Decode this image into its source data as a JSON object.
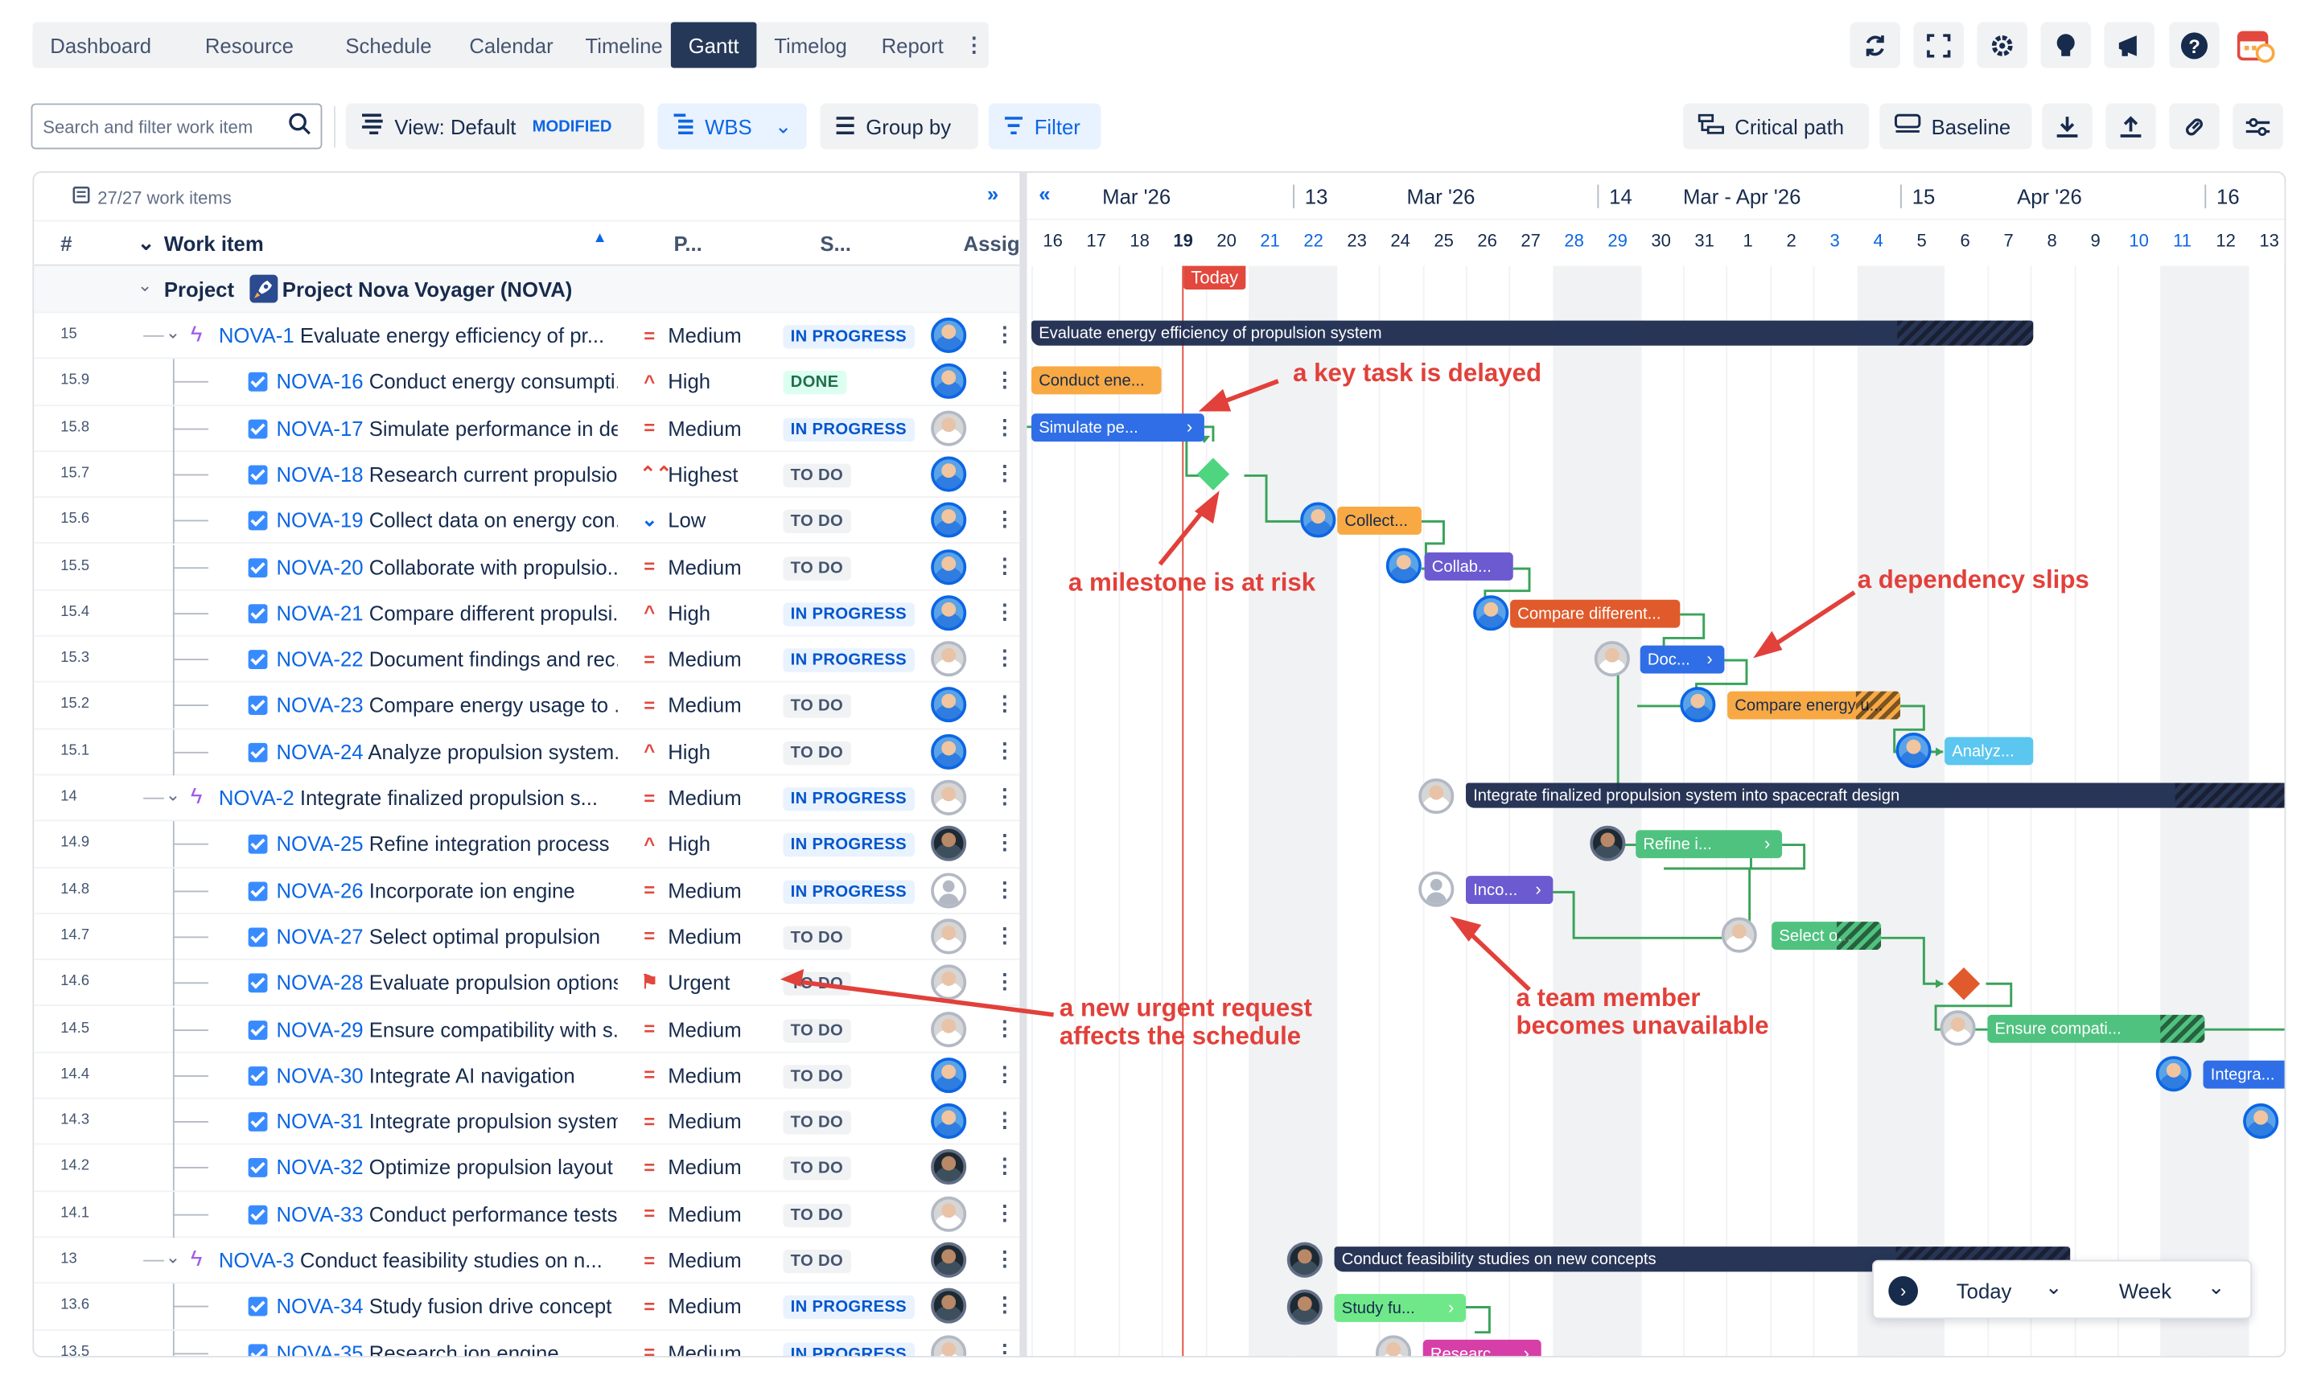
{
  "tabs": [
    "Dashboard",
    "Resource",
    "Schedule",
    "Calendar",
    "Timeline",
    "Gantt",
    "Timelog",
    "Report"
  ],
  "active_tab": "Gantt",
  "search": {
    "placeholder": "Search and filter work item"
  },
  "toolbar": {
    "view_label": "View: Default",
    "view_badge": "MODIFIED",
    "wbs_label": "WBS",
    "group_label": "Group by",
    "filter_label": "Filter",
    "critical_label": "Critical path",
    "baseline_label": "Baseline"
  },
  "list": {
    "count": "27/27 work items",
    "col_num": "#",
    "col_work": "Work item",
    "col_pri": "P...",
    "col_status": "S...",
    "col_assignee": "Assig",
    "project_label": "Project",
    "project_name": "Project Nova Voyager (NOVA)"
  },
  "rows": [
    {
      "num": "15",
      "key": "NOVA-1",
      "title": "Evaluate energy efficiency of pr...",
      "priority": "Medium",
      "status": "IN PROGRESS",
      "level": 1,
      "avatar": "a"
    },
    {
      "num": "15.9",
      "key": "NOVA-16",
      "title": "Conduct energy consumpti...",
      "priority": "High",
      "status": "DONE",
      "level": 2,
      "avatar": "a"
    },
    {
      "num": "15.8",
      "key": "NOVA-17",
      "title": "Simulate performance in de...",
      "priority": "Medium",
      "status": "IN PROGRESS",
      "level": 2,
      "avatar": "b"
    },
    {
      "num": "15.7",
      "key": "NOVA-18",
      "title": "Research current propulsio...",
      "priority": "Highest",
      "status": "TO DO",
      "level": 2,
      "avatar": "a"
    },
    {
      "num": "15.6",
      "key": "NOVA-19",
      "title": "Collect data on energy con...",
      "priority": "Low",
      "status": "TO DO",
      "level": 2,
      "avatar": "a"
    },
    {
      "num": "15.5",
      "key": "NOVA-20",
      "title": "Collaborate with propulsio...",
      "priority": "Medium",
      "status": "TO DO",
      "level": 2,
      "avatar": "a"
    },
    {
      "num": "15.4",
      "key": "NOVA-21",
      "title": "Compare different propulsi...",
      "priority": "High",
      "status": "IN PROGRESS",
      "level": 2,
      "avatar": "a"
    },
    {
      "num": "15.3",
      "key": "NOVA-22",
      "title": "Document findings and rec...",
      "priority": "Medium",
      "status": "IN PROGRESS",
      "level": 2,
      "avatar": "b"
    },
    {
      "num": "15.2",
      "key": "NOVA-23",
      "title": "Compare energy usage to ...",
      "priority": "Medium",
      "status": "TO DO",
      "level": 2,
      "avatar": "a"
    },
    {
      "num": "15.1",
      "key": "NOVA-24",
      "title": "Analyze propulsion system...",
      "priority": "High",
      "status": "TO DO",
      "level": 2,
      "avatar": "a"
    },
    {
      "num": "14",
      "key": "NOVA-2",
      "title": "Integrate finalized propulsion s...",
      "priority": "Medium",
      "status": "IN PROGRESS",
      "level": 1,
      "avatar": "b"
    },
    {
      "num": "14.9",
      "key": "NOVA-25",
      "title": "Refine integration process",
      "priority": "High",
      "status": "IN PROGRESS",
      "level": 2,
      "avatar": "c"
    },
    {
      "num": "14.8",
      "key": "NOVA-26",
      "title": "Incorporate ion engine",
      "priority": "Medium",
      "status": "IN PROGRESS",
      "level": 2,
      "avatar": "d"
    },
    {
      "num": "14.7",
      "key": "NOVA-27",
      "title": "Select optimal propulsion",
      "priority": "Medium",
      "status": "TO DO",
      "level": 2,
      "avatar": "b"
    },
    {
      "num": "14.6",
      "key": "NOVA-28",
      "title": "Evaluate propulsion options",
      "priority": "Urgent",
      "status": "TO DO",
      "level": 2,
      "avatar": "b"
    },
    {
      "num": "14.5",
      "key": "NOVA-29",
      "title": "Ensure compatibility with s...",
      "priority": "Medium",
      "status": "TO DO",
      "level": 2,
      "avatar": "b"
    },
    {
      "num": "14.4",
      "key": "NOVA-30",
      "title": "Integrate AI navigation",
      "priority": "Medium",
      "status": "TO DO",
      "level": 2,
      "avatar": "a"
    },
    {
      "num": "14.3",
      "key": "NOVA-31",
      "title": "Integrate propulsion system",
      "priority": "Medium",
      "status": "TO DO",
      "level": 2,
      "avatar": "a"
    },
    {
      "num": "14.2",
      "key": "NOVA-32",
      "title": "Optimize propulsion layout",
      "priority": "Medium",
      "status": "TO DO",
      "level": 2,
      "avatar": "c"
    },
    {
      "num": "14.1",
      "key": "NOVA-33",
      "title": "Conduct performance tests",
      "priority": "Medium",
      "status": "TO DO",
      "level": 2,
      "avatar": "b"
    },
    {
      "num": "13",
      "key": "NOVA-3",
      "title": "Conduct feasibility studies on n...",
      "priority": "Medium",
      "status": "TO DO",
      "level": 1,
      "avatar": "c"
    },
    {
      "num": "13.6",
      "key": "NOVA-34",
      "title": "Study fusion drive concept",
      "priority": "Medium",
      "status": "IN PROGRESS",
      "level": 2,
      "avatar": "c"
    },
    {
      "num": "13.5",
      "key": "NOVA-35",
      "title": "Research ion engine",
      "priority": "Medium",
      "status": "IN PROGRESS",
      "level": 2,
      "avatar": "b"
    }
  ],
  "timeline": {
    "months": [
      "Mar '26",
      "Mar '26",
      "Mar - Apr '26",
      "Apr '26"
    ],
    "weeks": [
      "13",
      "14",
      "15",
      "16"
    ],
    "days": [
      "16",
      "17",
      "18",
      "19",
      "20",
      "21",
      "22",
      "23",
      "24",
      "25",
      "26",
      "27",
      "28",
      "29",
      "30",
      "31",
      "1",
      "2",
      "3",
      "4",
      "5",
      "6",
      "7",
      "8",
      "9",
      "10",
      "11",
      "12",
      "13"
    ],
    "today_label": "Today"
  },
  "bars": [
    {
      "label": "Evaluate energy efficiency of propulsion system",
      "color": "#1d2b4f"
    },
    {
      "label": "Conduct ene...",
      "color": "#f8a944"
    },
    {
      "label": "Simulate pe...",
      "color": "#2f6ee6"
    },
    {
      "label": "Collect...",
      "color": "#f8a944"
    },
    {
      "label": "Collab...",
      "color": "#6c5ad0"
    },
    {
      "label": "Compare different...",
      "color": "#e05a2b"
    },
    {
      "label": "Doc...",
      "color": "#2f6ee6"
    },
    {
      "label": "Compare energy u...",
      "color": "#f8a944"
    },
    {
      "label": "Analyz...",
      "color": "#5bc6ef"
    },
    {
      "label": "Integrate finalized propulsion system into spacecraft design",
      "color": "#1d2b4f"
    },
    {
      "label": "Refine i...",
      "color": "#4fc27f"
    },
    {
      "label": "Inco...",
      "color": "#6c5ad0"
    },
    {
      "label": "Select o...",
      "color": "#4fc27f"
    },
    {
      "label": "Ensure compati...",
      "color": "#4fc27f"
    },
    {
      "label": "Integra...",
      "color": "#2f6ee6"
    },
    {
      "label": "Conduct feasibility studies on new concepts",
      "color": "#1d2b4f"
    },
    {
      "label": "Study fu...",
      "color": "#6fe88a"
    },
    {
      "label": "Researc...",
      "color": "#d63fa8"
    }
  ],
  "annotations": {
    "delayed": "a key task is delayed",
    "milestone": "a milestone is at risk",
    "dependency": "a dependency slips",
    "unavailable_1": "a team member",
    "unavailable_2": "becomes unavailable",
    "urgent_1": "a new urgent request",
    "urgent_2": "affects the schedule"
  },
  "footer": {
    "today_label": "Today",
    "scale_label": "Week"
  },
  "colors": {
    "accent": "#0c66e4",
    "annotation": "#e2403a",
    "today_line": "#e2483d"
  }
}
